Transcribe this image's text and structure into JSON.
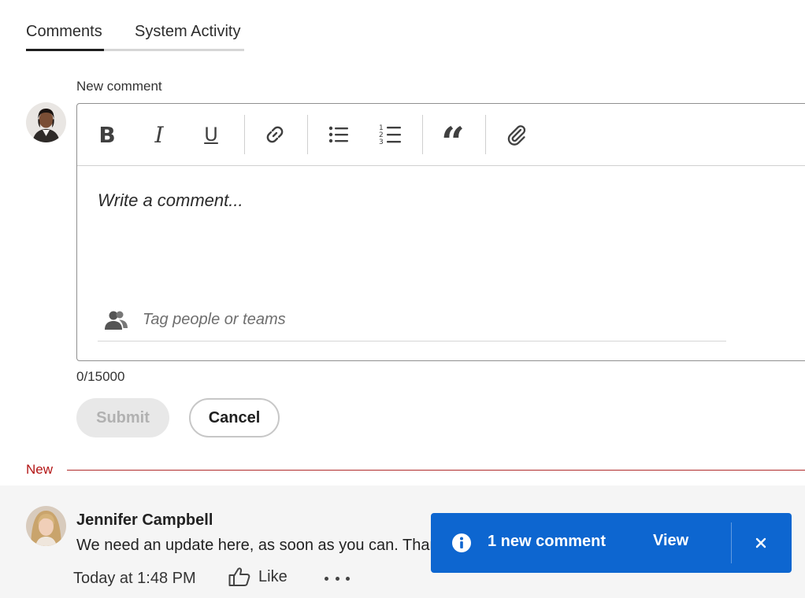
{
  "tabs": [
    {
      "label": "Comments",
      "selected": true
    },
    {
      "label": "System Activity",
      "selected": false
    }
  ],
  "new_comment": {
    "label": "New comment",
    "placeholder": "Write a comment...",
    "tag_placeholder": "Tag people or teams",
    "counter": "0/15000",
    "toolbar_icons": [
      "bold-icon",
      "italic-icon",
      "underline-icon",
      "link-icon",
      "bullet-list-icon",
      "numbered-list-icon",
      "quote-icon",
      "attachment-icon"
    ],
    "toolbar_glyphs": {
      "bold": "B",
      "italic": "I",
      "underline": "U",
      "quote": "“"
    }
  },
  "buttons": {
    "submit": "Submit",
    "cancel": "Cancel"
  },
  "divider": {
    "label": "New",
    "color": "#b31515"
  },
  "comment": {
    "author": "Jennifer Campbell",
    "text": "We need an update here, as soon as you can. Thanks!",
    "timestamp": "Today at 1:48 PM",
    "like_label": "Like"
  },
  "toast": {
    "message": "1 new comment",
    "action": "View",
    "color": "#0d66d0"
  }
}
